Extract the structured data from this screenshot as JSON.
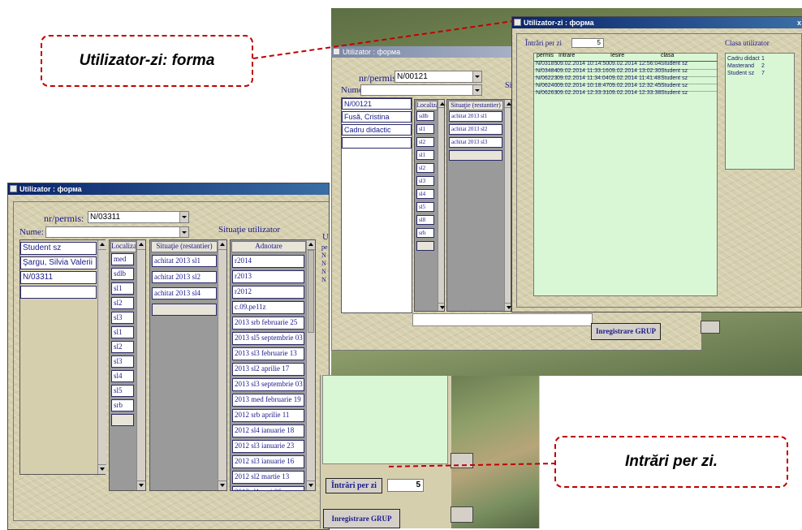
{
  "callouts": {
    "top": "Utilizator-zi: forma",
    "bottom": "Intrări per zi."
  },
  "win_left": {
    "title": "Utilizator : форма",
    "permis_label": "nr/permis:",
    "permis_value": "N/03311",
    "nume_label": "Nume:",
    "nume_value": "",
    "situatie_label": "Situaţie utilizator",
    "info_items": [
      "Student sz",
      "Şargu, Silvia Valerii",
      "N/03311"
    ],
    "col_localizare": "Localizar",
    "localizare_items": [
      "med",
      "sdlb",
      "sl1",
      "sl2",
      "sl3",
      "sl1",
      "sl2",
      "sl3",
      "sl4",
      "sl5",
      "srb"
    ],
    "col_situatie": "Situaţie (restantier)",
    "situatie_items": [
      "achitat 2013 sl1",
      "achitat 2013 sl2",
      "achitat 2013 sl4"
    ],
    "col_adnotare": "Adnotare",
    "adnotare_items": [
      "r2014",
      "r2013",
      "r2012",
      "c.09.pe11z",
      "2013 srb februarie 25",
      "2013 sl5 septembrie 03",
      "2013 sl3 februarie 13",
      "2013 sl2 aprilie 17",
      "2013 sl3 septembrie 03",
      "2013 med februarie 19",
      "2012 srb aprilie 11",
      "2012 sl4 ianuarie 18",
      "2012 sl3 ianuarie 23",
      "2012 sl3 ianuarie 16",
      "2012 sl2 martie 13",
      "2012 sl1 mai 06"
    ],
    "partial_right": [
      "U",
      "pe",
      "N",
      "N",
      "N",
      "N"
    ],
    "intrari_label": "Întrări per zi",
    "intrari_value": "5",
    "grup_button": "Inregistrare GRUP"
  },
  "win_mid": {
    "title": "Utilizator : форма",
    "permis_label": "nr/permis:",
    "permis_value": "N/00121",
    "nume_label": "Nume:",
    "nume_value": "",
    "situatie_partial": "Si",
    "info_items": [
      "N/00121",
      "Fusă, Cristina",
      "Cadru didactic"
    ],
    "col_localizare": "Localizar",
    "localizare_items": [
      "sdlb",
      "sl1",
      "sl2",
      "sl1",
      "sl2",
      "sl3",
      "sl4",
      "sl5",
      "sl8",
      "srb"
    ],
    "col_situatie": "Situaţie (restantier)",
    "situatie_items": [
      "achitat 2013 sl1",
      "achitat 2013 sl2",
      "achitat 2013 sl3"
    ],
    "grup_button": "Inregistrare GRUP"
  },
  "win_front": {
    "title": "Utilizator-zi : форма",
    "close_glyph": "x",
    "intrari_label": "Întrări per zi",
    "intrari_value": "5",
    "clasa_label": "Clasa utilizator",
    "table_headers": [
      "permis",
      "Intrare",
      "Iesire",
      "clasa"
    ],
    "table_rows": [
      [
        "N/03185",
        "09.02.2014 10:14:50",
        "09.02.2014 12:56:04",
        "Student sz"
      ],
      [
        "N/03484",
        "09.02.2014 11:33:16",
        "09.02.2014 13:02:30",
        "Student sz"
      ],
      [
        "N/06223",
        "09.02.2014 11:34:04",
        "09.02.2014 11:41:48",
        "Student sz"
      ],
      [
        "N/06240",
        "09.02.2014 10:18:47",
        "09.02.2014 12:32:45",
        "Student sz"
      ],
      [
        "N/06263",
        "09.02.2014 12:33:31",
        "09.02.2014 12:33:38",
        "Student sz"
      ]
    ],
    "clasa_rows": [
      [
        "Cadru didact",
        "1"
      ],
      [
        "Masterand",
        "2"
      ],
      [
        "Student sz",
        "7"
      ]
    ]
  }
}
